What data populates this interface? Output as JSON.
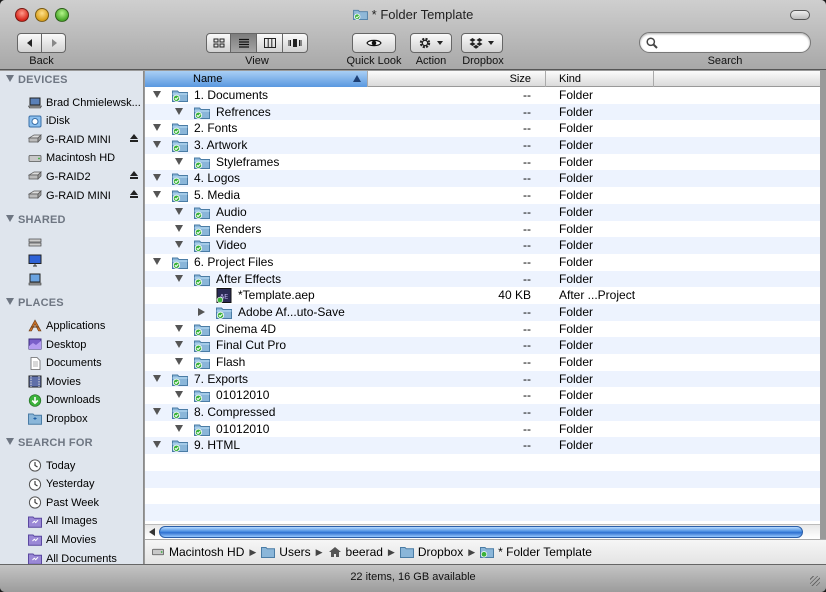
{
  "window": {
    "title": "* Folder Template"
  },
  "toolbar": {
    "back_label": "Back",
    "view_label": "View",
    "quicklook_label": "Quick Look",
    "action_label": "Action",
    "dropbox_label": "Dropbox",
    "search_label": "Search",
    "search_placeholder": ""
  },
  "sidebar": {
    "devices_header": "DEVICES",
    "devices": [
      {
        "label": "Brad Chmielewsk...",
        "icon": "laptop-icon",
        "eject": false
      },
      {
        "label": "iDisk",
        "icon": "idisk-icon",
        "eject": false
      },
      {
        "label": "G-RAID MINI",
        "icon": "external-drive-icon",
        "eject": true
      },
      {
        "label": "Macintosh HD",
        "icon": "hard-drive-icon",
        "eject": false
      },
      {
        "label": "G-RAID2",
        "icon": "external-drive-icon",
        "eject": true
      },
      {
        "label": "G-RAID MINI",
        "icon": "external-drive-icon",
        "eject": true
      }
    ],
    "shared_header": "SHARED",
    "shared": [
      {
        "icon": "network-server-icon"
      },
      {
        "icon": "network-display-icon"
      },
      {
        "icon": "network-computer-icon"
      }
    ],
    "places_header": "PLACES",
    "places": [
      {
        "label": "Applications",
        "icon": "applications-icon"
      },
      {
        "label": "Desktop",
        "icon": "desktop-icon"
      },
      {
        "label": "Documents",
        "icon": "documents-icon"
      },
      {
        "label": "Movies",
        "icon": "movies-icon"
      },
      {
        "label": "Downloads",
        "icon": "downloads-icon"
      },
      {
        "label": "Dropbox",
        "icon": "dropbox-folder-icon"
      }
    ],
    "search_header": "SEARCH FOR",
    "search_for": [
      {
        "label": "Today",
        "icon": "clock-icon"
      },
      {
        "label": "Yesterday",
        "icon": "clock-icon"
      },
      {
        "label": "Past Week",
        "icon": "clock-icon"
      },
      {
        "label": "All Images",
        "icon": "smart-folder-icon"
      },
      {
        "label": "All Movies",
        "icon": "smart-folder-icon"
      },
      {
        "label": "All Documents",
        "icon": "smart-folder-icon"
      }
    ]
  },
  "columns": {
    "name": "Name",
    "size": "Size",
    "kind": "Kind"
  },
  "files": [
    {
      "name": "1. Documents",
      "level": 0,
      "disclosure": "open",
      "type": "folder",
      "size": "--",
      "kind": "Folder"
    },
    {
      "name": "Refrences",
      "level": 1,
      "disclosure": "open",
      "type": "folder",
      "size": "--",
      "kind": "Folder"
    },
    {
      "name": "2. Fonts",
      "level": 0,
      "disclosure": "open",
      "type": "folder",
      "size": "--",
      "kind": "Folder"
    },
    {
      "name": "3. Artwork",
      "level": 0,
      "disclosure": "open",
      "type": "folder",
      "size": "--",
      "kind": "Folder"
    },
    {
      "name": "Styleframes",
      "level": 1,
      "disclosure": "open",
      "type": "folder",
      "size": "--",
      "kind": "Folder"
    },
    {
      "name": "4. Logos",
      "level": 0,
      "disclosure": "open",
      "type": "folder",
      "size": "--",
      "kind": "Folder"
    },
    {
      "name": "5. Media",
      "level": 0,
      "disclosure": "open",
      "type": "folder",
      "size": "--",
      "kind": "Folder"
    },
    {
      "name": "Audio",
      "level": 1,
      "disclosure": "open",
      "type": "folder",
      "size": "--",
      "kind": "Folder"
    },
    {
      "name": "Renders",
      "level": 1,
      "disclosure": "open",
      "type": "folder",
      "size": "--",
      "kind": "Folder"
    },
    {
      "name": "Video",
      "level": 1,
      "disclosure": "open",
      "type": "folder",
      "size": "--",
      "kind": "Folder"
    },
    {
      "name": "6. Project Files",
      "level": 0,
      "disclosure": "open",
      "type": "folder",
      "size": "--",
      "kind": "Folder"
    },
    {
      "name": "After Effects",
      "level": 1,
      "disclosure": "open",
      "type": "folder",
      "size": "--",
      "kind": "Folder"
    },
    {
      "name": "*Template.aep",
      "level": 2,
      "disclosure": "none",
      "type": "aep",
      "size": "40 KB",
      "kind": "After ...Project"
    },
    {
      "name": "Adobe Af...uto-Save",
      "level": 2,
      "disclosure": "closed",
      "type": "folder",
      "size": "--",
      "kind": "Folder"
    },
    {
      "name": "Cinema 4D",
      "level": 1,
      "disclosure": "open",
      "type": "folder",
      "size": "--",
      "kind": "Folder"
    },
    {
      "name": "Final Cut Pro",
      "level": 1,
      "disclosure": "open",
      "type": "folder",
      "size": "--",
      "kind": "Folder"
    },
    {
      "name": "Flash",
      "level": 1,
      "disclosure": "open",
      "type": "folder",
      "size": "--",
      "kind": "Folder"
    },
    {
      "name": "7. Exports",
      "level": 0,
      "disclosure": "open",
      "type": "folder",
      "size": "--",
      "kind": "Folder"
    },
    {
      "name": "01012010",
      "level": 1,
      "disclosure": "open",
      "type": "folder",
      "size": "--",
      "kind": "Folder"
    },
    {
      "name": "8. Compressed",
      "level": 0,
      "disclosure": "open",
      "type": "folder",
      "size": "--",
      "kind": "Folder"
    },
    {
      "name": "01012010",
      "level": 1,
      "disclosure": "open",
      "type": "folder",
      "size": "--",
      "kind": "Folder"
    },
    {
      "name": "9. HTML",
      "level": 0,
      "disclosure": "open",
      "type": "folder",
      "size": "--",
      "kind": "Folder"
    }
  ],
  "empty_rows": 5,
  "pathbar": [
    {
      "label": "Macintosh HD",
      "icon": "hard-drive-icon"
    },
    {
      "label": "Users",
      "icon": "folder-icon"
    },
    {
      "label": "beerad",
      "icon": "home-icon"
    },
    {
      "label": "Dropbox",
      "icon": "folder-icon"
    },
    {
      "label": "* Folder Template",
      "icon": "synced-folder-icon"
    }
  ],
  "status": {
    "text": "22 items, 16 GB available"
  },
  "colors": {
    "sidebar_bg": "#dfe5ed",
    "selected_header": "#5a98e0",
    "row_alt": "#edf3fe",
    "sync_check": "#3bb23b"
  }
}
